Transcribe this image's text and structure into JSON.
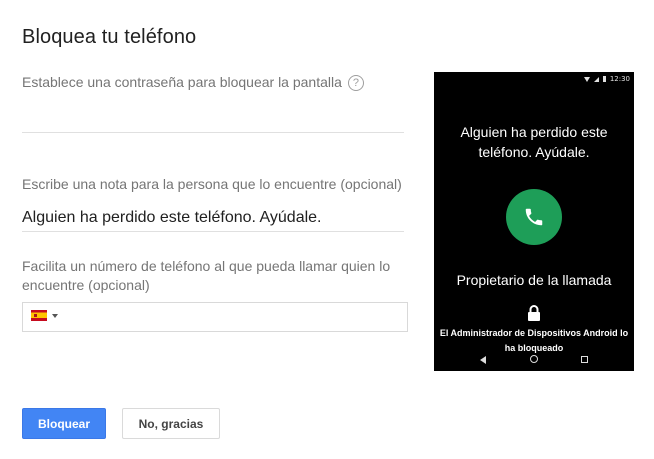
{
  "title": "Bloquea tu teléfono",
  "password_label": "Establece una contraseña para bloquear la pantalla",
  "help_glyph": "?",
  "password_value": "",
  "note_label": "Escribe una nota para la persona que lo encuentre (opcional)",
  "note_value": "Alguien ha perdido este teléfono. Ayúdale.",
  "phone_label": "Facilita un número de teléfono al que pueda llamar quien lo encuentre (opcional)",
  "phone_country": "ES",
  "phone_value": "",
  "buttons": {
    "lock": "Bloquear",
    "no_thanks": "No, gracias"
  },
  "preview": {
    "status_time": "12:30",
    "message": "Alguien ha perdido este teléfono. Ayúdale.",
    "owner_call": "Propietario de la llamada",
    "admin_message": "El Administrador de Dispositivos Android lo ha bloqueado"
  },
  "colors": {
    "primary": "#4285f4",
    "call_green": "#1e9e58",
    "preview_bg": "#000000"
  }
}
